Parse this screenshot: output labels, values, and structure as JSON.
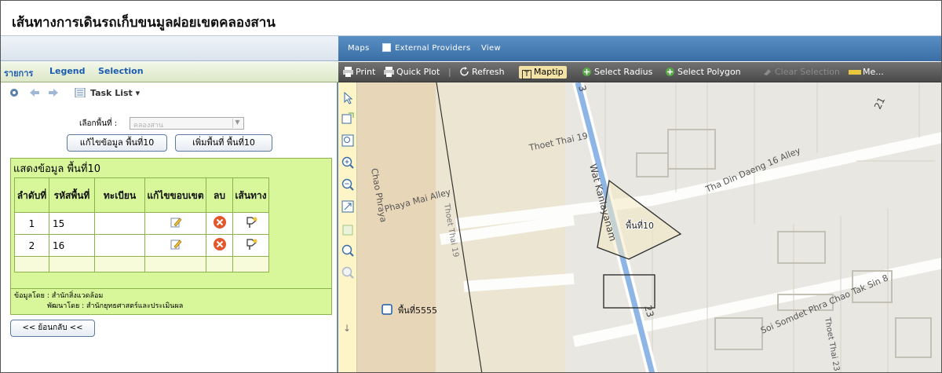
{
  "page_title": "เส้นทางการเดินรถเก็บขนมูลฝอยเขตคลองสาน",
  "map_menu": {
    "maps": "Maps",
    "external": "External Providers",
    "view": "View"
  },
  "tabs": {
    "task": "รายการ",
    "legend": "Legend",
    "selection": "Selection"
  },
  "task_toolbar": {
    "task_list": "Task List ▾"
  },
  "select": {
    "label": "เลือกพื้นที่ :",
    "value": "คลองสาน"
  },
  "buttons": {
    "edit": "แก้ไขข้อมูล พื้นที่10",
    "add": "เพิ่มพื้นที่ พื้นที่10",
    "back": "<< ย้อนกลับ <<"
  },
  "grid": {
    "title": "แสดงข้อมูล พื้นที่10",
    "headers": [
      "ลำดับที่",
      "รหัสพื้นที่",
      "ทะเบียน",
      "แก้ไขขอบเขต",
      "ลบ",
      "เส้นทาง"
    ],
    "rows": [
      {
        "no": "1",
        "code": "15",
        "reg": ""
      },
      {
        "no": "2",
        "code": "16",
        "reg": ""
      }
    ]
  },
  "footer": {
    "line1": "ข้อมูลโดย : สำนักสิ่งแวดล้อม",
    "line2": "พัฒนาโดย : สำนักยุทธศาสตร์และประเมินผล"
  },
  "map_toolbar": {
    "print": "Print",
    "quick_plot": "Quick Plot",
    "refresh": "Refresh",
    "maptip": "Maptip",
    "select_radius": "Select Radius",
    "select_polygon": "Select Polygon",
    "clear_selection": "Clear Selection",
    "measure": "Me..."
  },
  "map_labels": {
    "wat_kanlayanam": "Wat Kanlayanam",
    "thoet_thai_19": "Thoet Thai 19",
    "phaya_mai_alley": "Phaya Mai Alley",
    "chao_phraya": "Chao Phraya",
    "tha_din_daeng_16": "Tha Din Daeng 16 Alley",
    "soi_somdet": "Soi Somdet Phra Chao Tak Sin 8",
    "thoet_thai_23": "Thoet Thai 23",
    "road_23": "23",
    "road_3": "3",
    "road_21": "21",
    "area_10": "พื้นที่10",
    "area_5555": "พื้นที่5555"
  },
  "colors": {
    "accent": "#3a6ea5",
    "grid_bg": "#d8f69a",
    "polygon": "#333333"
  }
}
